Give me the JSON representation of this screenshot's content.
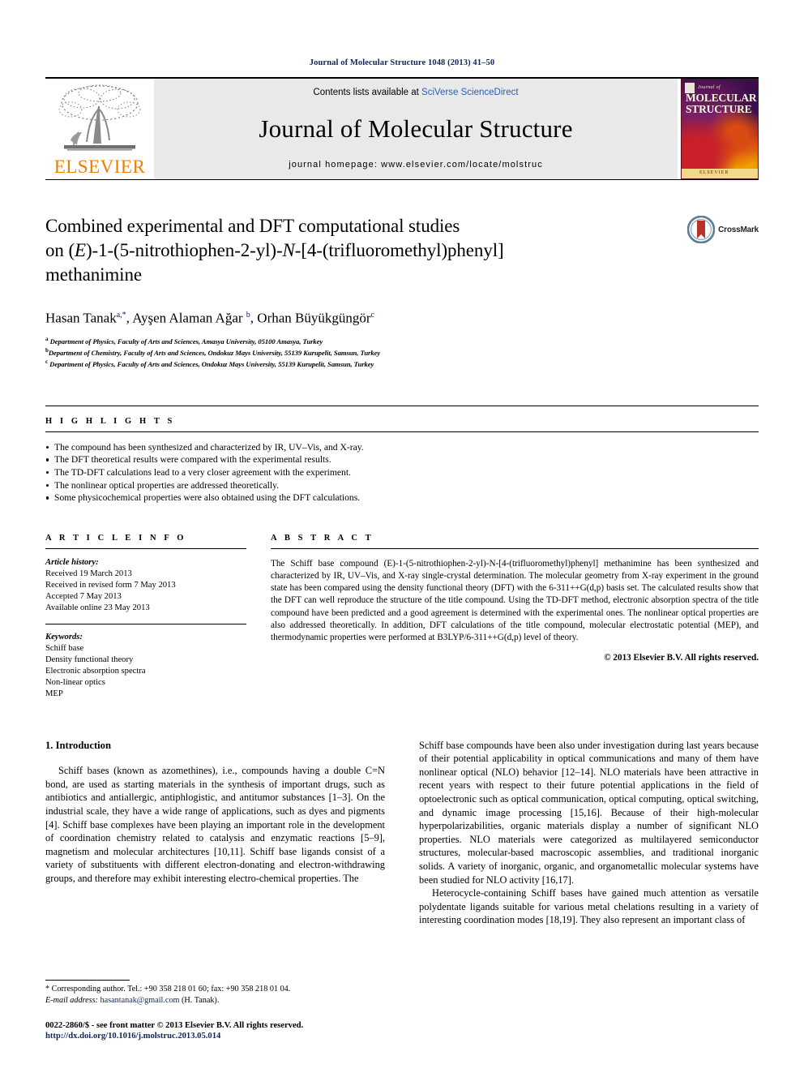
{
  "running_head": "Journal of Molecular Structure 1048 (2013) 41–50",
  "masthead": {
    "publisher": "ELSEVIER",
    "contents_prefix": "Contents lists available at ",
    "contents_link": "SciVerse ScienceDirect",
    "journal_title": "Journal of Molecular Structure",
    "homepage": "journal homepage: www.elsevier.com/locate/molstruc",
    "cover": {
      "journal_of": "Journal of",
      "line1": "MOLECULAR",
      "line2": "STRUCTURE",
      "footer": "ELSEVIER"
    }
  },
  "article": {
    "title_line1": "Combined experimental and DFT computational studies",
    "title_line2_a": "on (",
    "title_line2_e": "E",
    "title_line2_b": ")-1-(5-nitrothiophen-2-yl)-",
    "title_line2_n": "N",
    "title_line2_c": "-[4-(trifluoromethyl)phenyl]",
    "title_line3": "methanimine",
    "crossmark_label": "CrossMark",
    "authors_html": "Hasan Tanak, Ayşen Alaman Ağar, Orhan Büyükgüngör",
    "authors": [
      {
        "name": "Hasan Tanak",
        "sup": "a,*"
      },
      {
        "name": "Ayşen Alaman Ağar",
        "sup": "b"
      },
      {
        "name": "Orhan Büyükgüngör",
        "sup": "c"
      }
    ],
    "affiliations": [
      {
        "marker": "a",
        "text": "Department of Physics, Faculty of Arts and Sciences, Amasya University, 05100 Amasya, Turkey"
      },
      {
        "marker": "b",
        "text": "Department of Chemistry, Faculty of Arts and Sciences, Ondokuz Mays University, 55139 Kurupelit, Samsun, Turkey"
      },
      {
        "marker": "c",
        "text": "Department of Physics, Faculty of Arts and Sciences, Ondokuz Mays University, 55139 Kurupelit, Samsun, Turkey"
      }
    ]
  },
  "highlights": {
    "heading": "H I G H L I G H T S",
    "items": [
      "The compound has been synthesized and characterized by IR, UV–Vis, and X-ray.",
      "The DFT theoretical results were compared with the experimental results.",
      "The TD-DFT calculations lead to a very closer agreement with the experiment.",
      "The nonlinear optical properties are addressed theoretically.",
      "Some physicochemical properties were also obtained using the DFT calculations."
    ]
  },
  "article_info": {
    "heading": "A R T I C L E   I N F O",
    "history_label": "Article history:",
    "history": [
      "Received 19 March 2013",
      "Received in revised form 7 May 2013",
      "Accepted 7 May 2013",
      "Available online 23 May 2013"
    ],
    "keywords_label": "Keywords:",
    "keywords": [
      "Schiff base",
      "Density functional theory",
      "Electronic absorption spectra",
      "Non-linear optics",
      "MEP"
    ]
  },
  "abstract": {
    "heading": "A B S T R A C T",
    "text": "The Schiff base compound (E)-1-(5-nitrothiophen-2-yl)-N-[4-(trifluoromethyl)phenyl] methanimine has been synthesized and characterized by IR, UV–Vis, and X-ray single-crystal determination. The molecular geometry from X-ray experiment in the ground state has been compared using the density functional theory (DFT) with the 6-311++G(d,p) basis set. The calculated results show that the DFT can well reproduce the structure of the title compound. Using the TD-DFT method, electronic absorption spectra of the title compound have been predicted and a good agreement is determined with the experimental ones. The nonlinear optical properties are also addressed theoretically. In addition, DFT calculations of the title compound, molecular electrostatic potential (MEP), and thermodynamic properties were performed at B3LYP/6-311++G(d,p) level of theory.",
    "copyright": "© 2013 Elsevier B.V. All rights reserved."
  },
  "body": {
    "section_heading": "1. Introduction",
    "left_paragraph_1": "Schiff bases (known as azomethines), i.e., compounds having a double C=N bond, are used as starting materials in the synthesis of important drugs, such as antibiotics and antiallergic, antiphlogistic, and antitumor substances [1–3]. On the industrial scale, they have a wide range of applications, such as dyes and pigments [4]. Schiff base complexes have been playing an important role in the development of coordination chemistry related to catalysis and enzymatic reactions [5–9], magnetism and molecular architectures [10,11]. Schiff base ligands consist of a variety of substituents with different electron-donating and electron-withdrawing groups, and therefore may exhibit interesting electro-chemical properties. The",
    "right_paragraph_1": "Schiff base compounds have been also under investigation during last years because of their potential applicability in optical communications and many of them have nonlinear optical (NLO) behavior [12–14]. NLO materials have been attractive in recent years with respect to their future potential applications in the field of optoelectronic such as optical communication, optical computing, optical switching, and dynamic image processing [15,16]. Because of their high-molecular hyperpolarizabilities, organic materials display a number of significant NLO properties. NLO materials were categorized as multilayered semiconductor structures, molecular-based macroscopic assemblies, and traditional inorganic solids. A variety of inorganic, organic, and organometallic molecular systems have been studied for NLO activity [16,17].",
    "right_paragraph_2": "Heterocycle-containing Schiff bases have gained much attention as versatile polydentate ligands suitable for various metal chelations resulting in a variety of interesting coordination modes [18,19]. They also represent an important class of"
  },
  "footnote": {
    "corresponding": "* Corresponding author. Tel.: +90 358 218 01 60; fax: +90 358 218 01 04.",
    "email_label": "E-mail address:",
    "email": "hasantanak@gmail.com",
    "email_suffix": " (H. Tanak)."
  },
  "footer": {
    "line1": "0022-2860/$ - see front matter © 2013 Elsevier B.V. All rights reserved.",
    "doi": "http://dx.doi.org/10.1016/j.molstruc.2013.05.014"
  },
  "colors": {
    "link_blue": "#2a5db0",
    "dark_navy": "#12245c",
    "elsevier_orange": "#ef7d00",
    "banner_grey": "#e9e9e9",
    "crossmark_red": "#b8312a"
  }
}
